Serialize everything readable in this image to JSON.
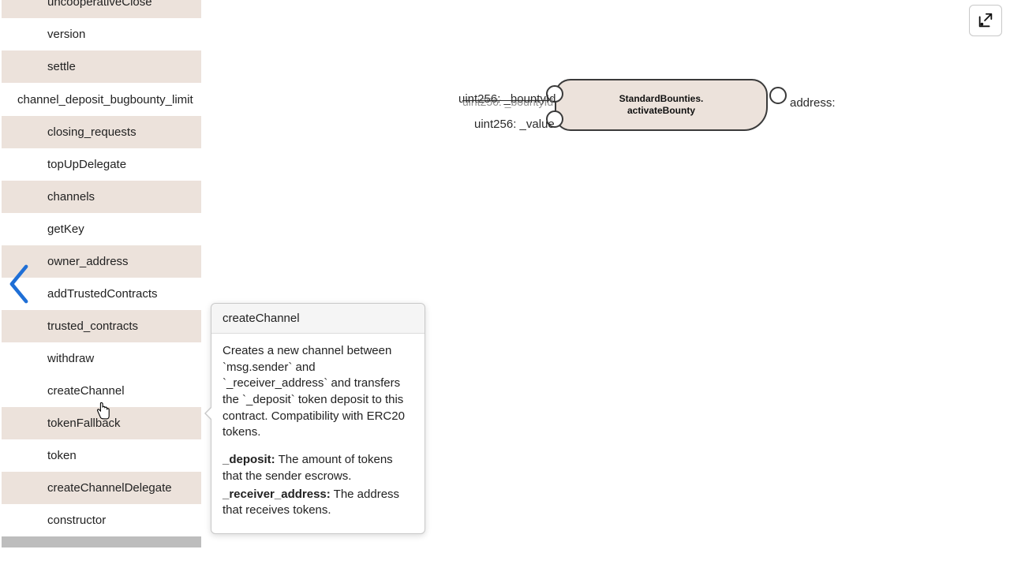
{
  "sidebar": {
    "top_items": [
      {
        "label": "uncooperativeClose"
      },
      {
        "label": "version"
      },
      {
        "label": "settle"
      }
    ],
    "group_header": "channel_deposit_bugbounty_limit",
    "items": [
      {
        "label": "closing_requests"
      },
      {
        "label": "topUpDelegate"
      },
      {
        "label": "channels"
      },
      {
        "label": "getKey"
      },
      {
        "label": "owner_address"
      },
      {
        "label": "addTrustedContracts"
      },
      {
        "label": "trusted_contracts"
      },
      {
        "label": "withdraw"
      },
      {
        "label": "createChannel"
      },
      {
        "label": "tokenFallback"
      },
      {
        "label": "token"
      },
      {
        "label": "createChannelDelegate"
      },
      {
        "label": "constructor"
      }
    ]
  },
  "node": {
    "title_line1": "StandardBounties.",
    "title_line2": "activateBounty",
    "inputs": [
      {
        "label": "uint256: _bountyId"
      },
      {
        "label": "uint256: _value"
      }
    ],
    "input_overlap": "uint256: _bountyId",
    "outputs": [
      {
        "label": "address:"
      }
    ]
  },
  "popover": {
    "title": "createChannel",
    "description": "Creates a new channel between `msg.sender` and `_receiver_address` and transfers the `_deposit` token deposit to this contract. Compatibility with ERC20 tokens.",
    "params": [
      {
        "name": "_deposit:",
        "desc": " The amount of tokens that the sender escrows."
      },
      {
        "name": "_receiver_address:",
        "desc": " The address that receives tokens."
      }
    ]
  },
  "colors": {
    "accent": "#ece2db",
    "nav_arrow": "#1f6fd6"
  }
}
